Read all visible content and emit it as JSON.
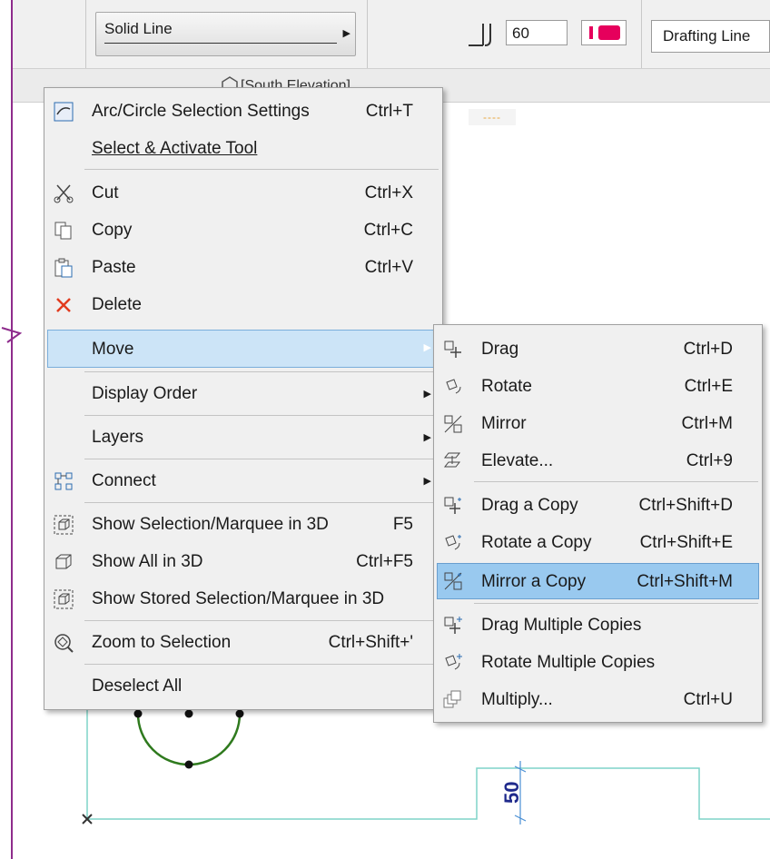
{
  "toolbar": {
    "line_type": "Solid Line",
    "pen_value": "60",
    "layer_name": "Drafting Line"
  },
  "tab": {
    "label": "[South Elevation]"
  },
  "canvas": {
    "dimension_label": "50",
    "line_color": "#7fd3c8",
    "arc_color": "#2f7a1e"
  },
  "context_menu": {
    "items": [
      {
        "label": "Arc/Circle Selection Settings",
        "shortcut": "Ctrl+T",
        "icon": "settings-pen-icon"
      },
      {
        "label": "Select & Activate Tool",
        "shortcut": ""
      },
      {
        "label": "Cut",
        "shortcut": "Ctrl+X",
        "icon": "scissors-icon"
      },
      {
        "label": "Copy",
        "shortcut": "Ctrl+C",
        "icon": "copy-icon"
      },
      {
        "label": "Paste",
        "shortcut": "Ctrl+V",
        "icon": "paste-icon"
      },
      {
        "label": "Delete",
        "shortcut": "",
        "icon": "delete-x-icon"
      },
      {
        "label": "Move",
        "shortcut": "",
        "has_submenu": true
      },
      {
        "label": "Display Order",
        "shortcut": "",
        "has_submenu": true
      },
      {
        "label": "Layers",
        "shortcut": "",
        "has_submenu": true
      },
      {
        "label": "Connect",
        "shortcut": "",
        "has_submenu": true,
        "icon": "connect-icon"
      },
      {
        "label": "Show Selection/Marquee in 3D",
        "shortcut": "F5",
        "icon": "marquee-3d-icon"
      },
      {
        "label": "Show All in 3D",
        "shortcut": "Ctrl+F5",
        "icon": "cube-icon"
      },
      {
        "label": "Show Stored Selection/Marquee in 3D",
        "shortcut": "",
        "icon": "stored-marquee-3d-icon"
      },
      {
        "label": "Zoom to Selection",
        "shortcut": "Ctrl+Shift+'",
        "icon": "zoom-selection-icon"
      },
      {
        "label": "Deselect All",
        "shortcut": ""
      }
    ]
  },
  "move_submenu": {
    "items": [
      {
        "label": "Drag",
        "shortcut": "Ctrl+D",
        "icon": "drag-icon"
      },
      {
        "label": "Rotate",
        "shortcut": "Ctrl+E",
        "icon": "rotate-icon"
      },
      {
        "label": "Mirror",
        "shortcut": "Ctrl+M",
        "icon": "mirror-icon"
      },
      {
        "label": "Elevate...",
        "shortcut": "Ctrl+9",
        "icon": "elevate-icon"
      },
      {
        "label": "Drag a Copy",
        "shortcut": "Ctrl+Shift+D",
        "icon": "drag-copy-icon"
      },
      {
        "label": "Rotate a Copy",
        "shortcut": "Ctrl+Shift+E",
        "icon": "rotate-copy-icon"
      },
      {
        "label": "Mirror a Copy",
        "shortcut": "Ctrl+Shift+M",
        "icon": "mirror-copy-icon"
      },
      {
        "label": "Drag Multiple Copies",
        "shortcut": "",
        "icon": "drag-multiple-icon"
      },
      {
        "label": "Rotate Multiple Copies",
        "shortcut": "",
        "icon": "rotate-multiple-icon"
      },
      {
        "label": "Multiply...",
        "shortcut": "Ctrl+U",
        "icon": "multiply-icon"
      }
    ]
  }
}
